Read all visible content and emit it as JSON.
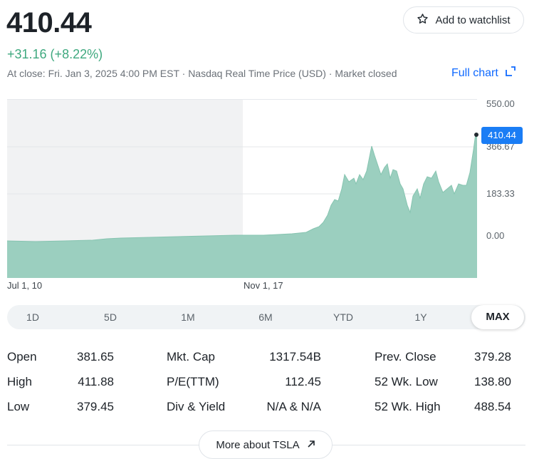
{
  "quote": {
    "price": "410.44",
    "change": "+31.16 (+8.22%)",
    "close_info": "At close: Fri. Jan 3, 2025 4:00 PM EST · Nasdaq Real Time Price (USD) · Market closed"
  },
  "actions": {
    "watchlist_label": "Add to watchlist",
    "full_chart_label": "Full chart",
    "more_about_label": "More about TSLA"
  },
  "chart": {
    "y_ticks": [
      "550.00",
      "366.67",
      "183.33",
      "0.00"
    ],
    "current_price_tag": "410.44",
    "x_ticks": [
      "Jul 1, 10",
      "Nov 1, 17"
    ]
  },
  "range_tabs": {
    "items": [
      "1D",
      "5D",
      "1M",
      "6M",
      "YTD",
      "1Y",
      "MAX"
    ],
    "selected": "MAX"
  },
  "stats": [
    [
      {
        "label": "Open",
        "value": "381.65"
      },
      {
        "label": "Mkt. Cap",
        "value": "1317.54B"
      },
      {
        "label": "Prev. Close",
        "value": "379.28"
      }
    ],
    [
      {
        "label": "High",
        "value": "411.88"
      },
      {
        "label": "P/E(TTM)",
        "value": "112.45"
      },
      {
        "label": "52 Wk. Low",
        "value": "138.80"
      }
    ],
    [
      {
        "label": "Low",
        "value": "379.45"
      },
      {
        "label": "Div & Yield",
        "value": "N/A & N/A"
      },
      {
        "label": "52 Wk. High",
        "value": "488.54"
      }
    ]
  ],
  "colors": {
    "positive": "#3fa97f",
    "accent": "#0f69ff",
    "area_fill": "#9bcfbf",
    "tag_bg": "#1a7df5"
  },
  "icons": [
    "star-icon",
    "expand-icon",
    "arrow-up-right-icon"
  ]
}
